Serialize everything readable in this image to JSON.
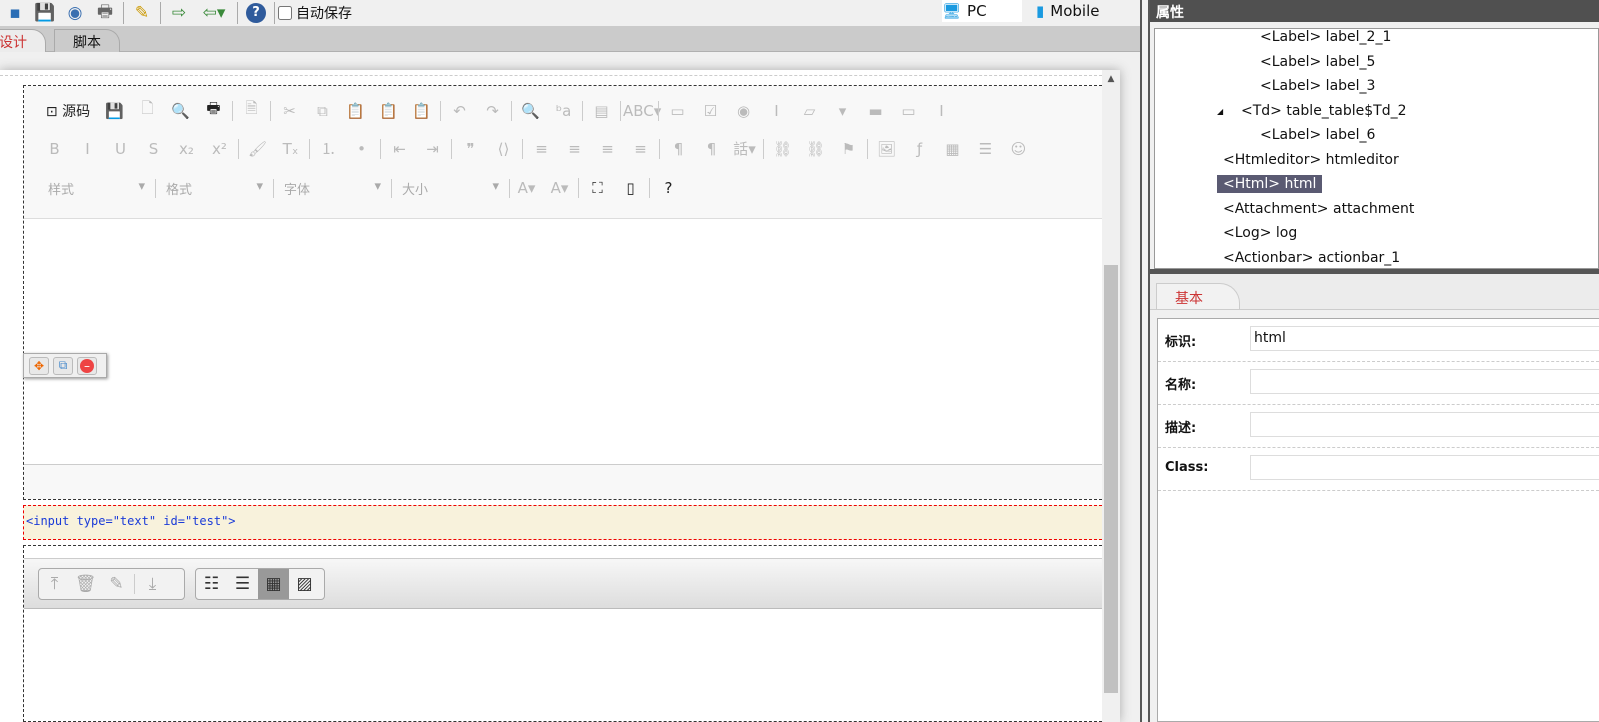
{
  "toolbar": {
    "items": [
      {
        "name": "save-icon",
        "glyph": "💾"
      },
      {
        "name": "preview-icon",
        "glyph": "👁"
      },
      {
        "name": "print-icon",
        "glyph": "🖶"
      },
      {
        "name": "wand-icon",
        "glyph": "✎"
      },
      {
        "name": "export-icon",
        "glyph": "⇨"
      },
      {
        "name": "import-icon",
        "glyph": "⇦▾"
      },
      {
        "name": "help-icon",
        "glyph": "?"
      }
    ],
    "autosave_label": "自动保存"
  },
  "devices": {
    "pc": "PC",
    "mobile": "Mobile"
  },
  "tabs": [
    "设计",
    "脚本"
  ],
  "editor": {
    "source_label": "源码",
    "row1": [
      "💾",
      "🗋",
      "🔍",
      "🖶",
      "|",
      "🗎",
      "|",
      "✂",
      "⧉",
      "📋",
      "📋",
      "📋",
      "|",
      "↶",
      "↷",
      "|",
      "🔍",
      "ᵇa",
      "|",
      "▤",
      "|",
      "ABC▾",
      "|",
      "▭",
      "☑",
      "◉",
      "Ⅰ",
      "▱",
      "▾",
      "▬",
      "▭",
      "Ⅰ"
    ],
    "row2": [
      "B",
      "I",
      "U",
      "S",
      "x₂",
      "x²",
      "|",
      "🖌",
      "Tₓ",
      "|",
      "⒈",
      "•",
      "|",
      "⇤",
      "⇥",
      "|",
      "❞",
      "⟨⟩",
      "|",
      "≡",
      "≡",
      "≡",
      "≡",
      "|",
      "¶",
      "¶",
      "話▾",
      "|",
      "⛓",
      "⛓",
      "⚑",
      "|",
      "🖼",
      "ƒ",
      "▦",
      "☰",
      "☺"
    ],
    "combos": [
      "样式",
      "格式",
      "字体",
      "大小"
    ],
    "row3": [
      "A▾",
      "A▾",
      "|",
      "⛶",
      "▯",
      "|",
      "?"
    ]
  },
  "html_component": {
    "code": "<input type=\"text\" id=\"test\">"
  },
  "attachment": {
    "group1": [
      "⤒",
      "🗑",
      "✎",
      "⤓"
    ],
    "group2": [
      "☷",
      "☰",
      "▦",
      "▨"
    ]
  },
  "panel": {
    "title": "属性",
    "tree": [
      {
        "label": "<Label> label_2_1",
        "level": 3
      },
      {
        "label": "<Label> label_5",
        "level": 3
      },
      {
        "label": "<Label> label_3",
        "level": 3
      },
      {
        "label": "<Td> table_table$Td_2",
        "level": 2,
        "expanded": true
      },
      {
        "label": "<Label> label_6",
        "level": 3
      },
      {
        "label": "<Htmleditor> htmleditor",
        "level": 1
      },
      {
        "label": "<Html> html",
        "level": 1,
        "selected": true
      },
      {
        "label": "<Attachment> attachment",
        "level": 1
      },
      {
        "label": "<Log> log",
        "level": 1
      },
      {
        "label": "<Actionbar> actionbar_1",
        "level": 1
      }
    ],
    "tab": "基本",
    "fields": [
      {
        "label": "标识:",
        "value": "html"
      },
      {
        "label": "名称:",
        "value": ""
      },
      {
        "label": "描述:",
        "value": ""
      },
      {
        "label": "Class:",
        "value": ""
      }
    ]
  }
}
